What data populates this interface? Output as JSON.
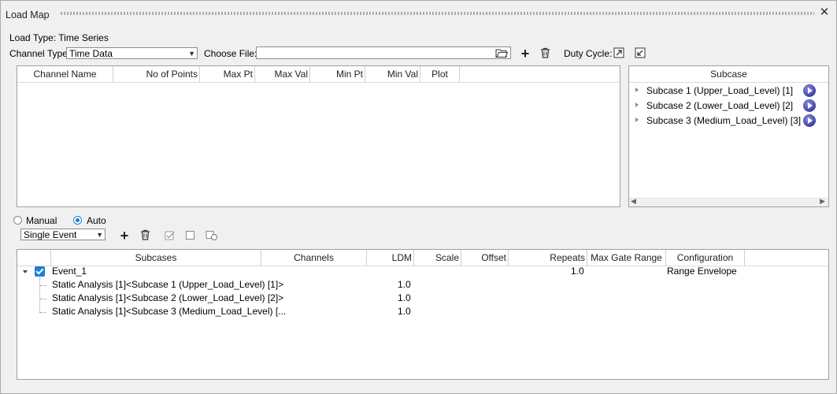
{
  "window": {
    "title": "Load Map",
    "close_glyph": "✕"
  },
  "load_type": {
    "label": "Load Type: Time Series"
  },
  "channel_type": {
    "label": "Channel Type:",
    "value": "Time Data"
  },
  "choose_file": {
    "label": "Choose File:",
    "value": ""
  },
  "duty_cycle": {
    "label": "Duty Cycle:"
  },
  "icons": {
    "folder": "folder-open-icon",
    "add": "plus-icon",
    "delete": "trash-icon",
    "export": "export-arrow-icon",
    "import": "import-arrow-icon"
  },
  "channel_table": {
    "columns": [
      "Channel Name",
      "No of Points",
      "Max Pt",
      "Max Val",
      "Min Pt",
      "Min Val",
      "Plot"
    ]
  },
  "subcase_panel": {
    "header": "Subcase",
    "items": [
      {
        "label": "Subcase 1 (Upper_Load_Level) [1]"
      },
      {
        "label": "Subcase 2 (Lower_Load_Level) [2]"
      },
      {
        "label": "Subcase 3 (Medium_Load_Level) [3]"
      }
    ]
  },
  "mode": {
    "manual": "Manual",
    "auto": "Auto",
    "selected": "auto"
  },
  "event_type": {
    "value": "Single Event"
  },
  "event_table": {
    "columns": [
      "Subcases",
      "Channels",
      "LDM",
      "Scale",
      "Offset",
      "Repeats",
      "Max Gate Range",
      "Configuration"
    ],
    "event": {
      "name": "Event_1",
      "repeats": "1.0",
      "configuration": "Range Envelope",
      "checked": true
    },
    "rows": [
      {
        "subcases": "Static Analysis [1]<Subcase 1 (Upper_Load_Level) [1]>",
        "ldm": "1.0"
      },
      {
        "subcases": "Static Analysis [1]<Subcase 2 (Lower_Load_Level) [2]>",
        "ldm": "1.0"
      },
      {
        "subcases": "Static Analysis [1]<Subcase 3 (Medium_Load_Level) [...",
        "ldm": "1.0"
      }
    ]
  },
  "colors": {
    "accent": "#1e7fd6",
    "play": "#3e3ea8",
    "border": "#a0a0a0"
  }
}
